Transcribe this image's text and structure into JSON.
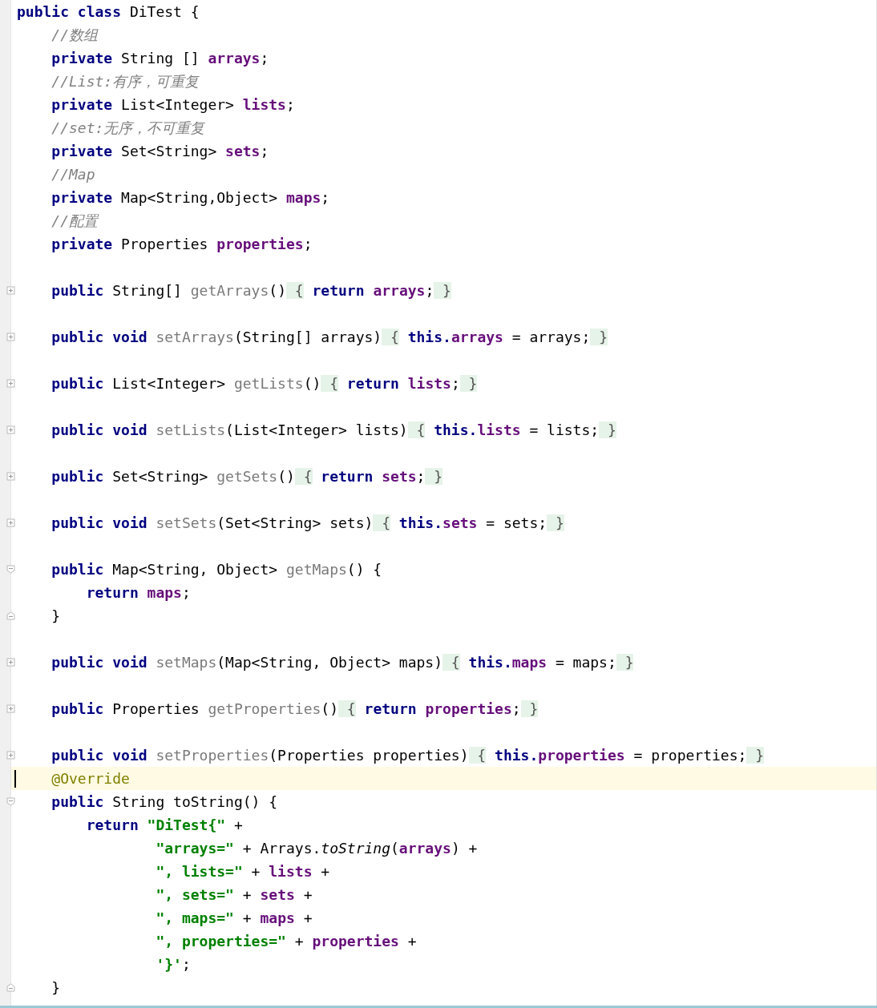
{
  "editor": {
    "lines": [
      {
        "kind": "code",
        "current": false,
        "tokens": [
          {
            "text": "public class ",
            "kind": "kw"
          },
          {
            "text": "DiTest {",
            "kind": "plain"
          }
        ]
      },
      {
        "kind": "code",
        "current": false,
        "tokens": [
          {
            "text": "    //数组",
            "kind": "comment"
          }
        ]
      },
      {
        "kind": "code",
        "current": false,
        "tokens": [
          {
            "text": "    private ",
            "kind": "kw"
          },
          {
            "text": "String [] ",
            "kind": "plain"
          },
          {
            "text": "arrays",
            "kind": "field"
          },
          {
            "text": ";",
            "kind": "plain"
          }
        ]
      },
      {
        "kind": "code",
        "current": false,
        "tokens": [
          {
            "text": "    //List:有序，可重复",
            "kind": "comment"
          }
        ]
      },
      {
        "kind": "code",
        "current": false,
        "tokens": [
          {
            "text": "    private ",
            "kind": "kw"
          },
          {
            "text": "List<Integer> ",
            "kind": "plain"
          },
          {
            "text": "lists",
            "kind": "field"
          },
          {
            "text": ";",
            "kind": "plain"
          }
        ]
      },
      {
        "kind": "code",
        "current": false,
        "tokens": [
          {
            "text": "    //set:无序，不可重复",
            "kind": "comment"
          }
        ]
      },
      {
        "kind": "code",
        "current": false,
        "tokens": [
          {
            "text": "    private ",
            "kind": "kw"
          },
          {
            "text": "Set<String> ",
            "kind": "plain"
          },
          {
            "text": "sets",
            "kind": "field"
          },
          {
            "text": ";",
            "kind": "plain"
          }
        ]
      },
      {
        "kind": "code",
        "current": false,
        "tokens": [
          {
            "text": "    //Map",
            "kind": "comment"
          }
        ]
      },
      {
        "kind": "code",
        "current": false,
        "tokens": [
          {
            "text": "    private ",
            "kind": "kw"
          },
          {
            "text": "Map<String,Object> ",
            "kind": "plain"
          },
          {
            "text": "maps",
            "kind": "field"
          },
          {
            "text": ";",
            "kind": "plain"
          }
        ]
      },
      {
        "kind": "code",
        "current": false,
        "tokens": [
          {
            "text": "    //配置",
            "kind": "comment"
          }
        ]
      },
      {
        "kind": "code",
        "current": false,
        "tokens": [
          {
            "text": "    private ",
            "kind": "kw"
          },
          {
            "text": "Properties ",
            "kind": "plain"
          },
          {
            "text": "properties",
            "kind": "field"
          },
          {
            "text": ";",
            "kind": "plain"
          }
        ]
      },
      {
        "kind": "blank",
        "current": false
      },
      {
        "kind": "code",
        "current": false,
        "fold": {
          "kind": "collapsed"
        },
        "tokens": [
          {
            "text": "    public ",
            "kind": "kw"
          },
          {
            "text": "String[] ",
            "kind": "plain"
          },
          {
            "text": "getArrays",
            "kind": "decl"
          },
          {
            "text": "()",
            "kind": "plain"
          },
          {
            "text": " {",
            "kind": "folded"
          },
          {
            "text": " return ",
            "kind": "kw"
          },
          {
            "text": "arrays",
            "kind": "field"
          },
          {
            "text": ";",
            "kind": "plain"
          },
          {
            "text": " }",
            "kind": "folded"
          }
        ]
      },
      {
        "kind": "blank",
        "current": false
      },
      {
        "kind": "code",
        "current": false,
        "fold": {
          "kind": "collapsed"
        },
        "tokens": [
          {
            "text": "    public void ",
            "kind": "kw"
          },
          {
            "text": "setArrays",
            "kind": "decl"
          },
          {
            "text": "(String[] arrays)",
            "kind": "plain"
          },
          {
            "text": " {",
            "kind": "folded"
          },
          {
            "text": " this.",
            "kind": "kw"
          },
          {
            "text": "arrays",
            "kind": "field"
          },
          {
            "text": " = arrays;",
            "kind": "plain"
          },
          {
            "text": " }",
            "kind": "folded"
          }
        ]
      },
      {
        "kind": "blank",
        "current": false
      },
      {
        "kind": "code",
        "current": false,
        "fold": {
          "kind": "collapsed"
        },
        "tokens": [
          {
            "text": "    public ",
            "kind": "kw"
          },
          {
            "text": "List<Integer> ",
            "kind": "plain"
          },
          {
            "text": "getLists",
            "kind": "decl"
          },
          {
            "text": "()",
            "kind": "plain"
          },
          {
            "text": " {",
            "kind": "folded"
          },
          {
            "text": " return ",
            "kind": "kw"
          },
          {
            "text": "lists",
            "kind": "field"
          },
          {
            "text": ";",
            "kind": "plain"
          },
          {
            "text": " }",
            "kind": "folded"
          }
        ]
      },
      {
        "kind": "blank",
        "current": false
      },
      {
        "kind": "code",
        "current": false,
        "fold": {
          "kind": "collapsed"
        },
        "tokens": [
          {
            "text": "    public void ",
            "kind": "kw"
          },
          {
            "text": "setLists",
            "kind": "decl"
          },
          {
            "text": "(List<Integer> lists)",
            "kind": "plain"
          },
          {
            "text": " {",
            "kind": "folded"
          },
          {
            "text": " this.",
            "kind": "kw"
          },
          {
            "text": "lists",
            "kind": "field"
          },
          {
            "text": " = lists;",
            "kind": "plain"
          },
          {
            "text": " }",
            "kind": "folded"
          }
        ]
      },
      {
        "kind": "blank",
        "current": false
      },
      {
        "kind": "code",
        "current": false,
        "fold": {
          "kind": "collapsed"
        },
        "tokens": [
          {
            "text": "    public ",
            "kind": "kw"
          },
          {
            "text": "Set<String> ",
            "kind": "plain"
          },
          {
            "text": "getSets",
            "kind": "decl"
          },
          {
            "text": "()",
            "kind": "plain"
          },
          {
            "text": " {",
            "kind": "folded"
          },
          {
            "text": " return ",
            "kind": "kw"
          },
          {
            "text": "sets",
            "kind": "field"
          },
          {
            "text": ";",
            "kind": "plain"
          },
          {
            "text": " }",
            "kind": "folded"
          }
        ]
      },
      {
        "kind": "blank",
        "current": false
      },
      {
        "kind": "code",
        "current": false,
        "fold": {
          "kind": "collapsed"
        },
        "tokens": [
          {
            "text": "    public void ",
            "kind": "kw"
          },
          {
            "text": "setSets",
            "kind": "decl"
          },
          {
            "text": "(Set<String> sets)",
            "kind": "plain"
          },
          {
            "text": " {",
            "kind": "folded"
          },
          {
            "text": " this.",
            "kind": "kw"
          },
          {
            "text": "sets",
            "kind": "field"
          },
          {
            "text": " = sets;",
            "kind": "plain"
          },
          {
            "text": " }",
            "kind": "folded"
          }
        ]
      },
      {
        "kind": "blank",
        "current": false
      },
      {
        "kind": "code",
        "current": false,
        "fold": {
          "kind": "open"
        },
        "tokens": [
          {
            "text": "    public ",
            "kind": "kw"
          },
          {
            "text": "Map<String, Object> ",
            "kind": "plain"
          },
          {
            "text": "getMaps",
            "kind": "decl"
          },
          {
            "text": "() {",
            "kind": "plain"
          }
        ]
      },
      {
        "kind": "code",
        "current": false,
        "tokens": [
          {
            "text": "        return ",
            "kind": "kw"
          },
          {
            "text": "maps",
            "kind": "field"
          },
          {
            "text": ";",
            "kind": "plain"
          }
        ]
      },
      {
        "kind": "code",
        "current": false,
        "fold": {
          "kind": "close"
        },
        "tokens": [
          {
            "text": "    }",
            "kind": "plain"
          }
        ]
      },
      {
        "kind": "blank",
        "current": false
      },
      {
        "kind": "code",
        "current": false,
        "fold": {
          "kind": "collapsed"
        },
        "tokens": [
          {
            "text": "    public void ",
            "kind": "kw"
          },
          {
            "text": "setMaps",
            "kind": "decl"
          },
          {
            "text": "(Map<String, Object> maps)",
            "kind": "plain"
          },
          {
            "text": " {",
            "kind": "folded"
          },
          {
            "text": " this.",
            "kind": "kw"
          },
          {
            "text": "maps",
            "kind": "field"
          },
          {
            "text": " = maps;",
            "kind": "plain"
          },
          {
            "text": " }",
            "kind": "folded"
          }
        ]
      },
      {
        "kind": "blank",
        "current": false
      },
      {
        "kind": "code",
        "current": false,
        "fold": {
          "kind": "collapsed"
        },
        "tokens": [
          {
            "text": "    public ",
            "kind": "kw"
          },
          {
            "text": "Properties ",
            "kind": "plain"
          },
          {
            "text": "getProperties",
            "kind": "decl"
          },
          {
            "text": "()",
            "kind": "plain"
          },
          {
            "text": " {",
            "kind": "folded"
          },
          {
            "text": " return ",
            "kind": "kw"
          },
          {
            "text": "properties",
            "kind": "field"
          },
          {
            "text": ";",
            "kind": "plain"
          },
          {
            "text": " }",
            "kind": "folded"
          }
        ]
      },
      {
        "kind": "blank",
        "current": false
      },
      {
        "kind": "code",
        "current": false,
        "fold": {
          "kind": "collapsed"
        },
        "tokens": [
          {
            "text": "    public void ",
            "kind": "kw"
          },
          {
            "text": "setProperties",
            "kind": "decl"
          },
          {
            "text": "(Properties properties)",
            "kind": "plain"
          },
          {
            "text": " {",
            "kind": "folded"
          },
          {
            "text": " this.",
            "kind": "kw"
          },
          {
            "text": "properties",
            "kind": "field"
          },
          {
            "text": " = properties;",
            "kind": "plain"
          },
          {
            "text": " }",
            "kind": "folded"
          }
        ]
      },
      {
        "kind": "code",
        "current": true,
        "tokens": [
          {
            "text": "    @Override",
            "kind": "annot"
          }
        ]
      },
      {
        "kind": "code",
        "current": false,
        "fold": {
          "kind": "open"
        },
        "tokens": [
          {
            "text": "    public ",
            "kind": "kw"
          },
          {
            "text": "String toString() {",
            "kind": "plain"
          }
        ]
      },
      {
        "kind": "code",
        "current": false,
        "tokens": [
          {
            "text": "        return ",
            "kind": "kw"
          },
          {
            "text": "\"DiTest{\"",
            "kind": "str"
          },
          {
            "text": " +",
            "kind": "plain"
          }
        ]
      },
      {
        "kind": "code",
        "current": false,
        "tokens": [
          {
            "text": "                \"arrays=\"",
            "kind": "str"
          },
          {
            "text": " + Arrays.",
            "kind": "plain"
          },
          {
            "text": "toString",
            "kind": "static"
          },
          {
            "text": "(",
            "kind": "plain"
          },
          {
            "text": "arrays",
            "kind": "field"
          },
          {
            "text": ") +",
            "kind": "plain"
          }
        ]
      },
      {
        "kind": "code",
        "current": false,
        "tokens": [
          {
            "text": "                \", lists=\"",
            "kind": "str"
          },
          {
            "text": " + ",
            "kind": "plain"
          },
          {
            "text": "lists",
            "kind": "field"
          },
          {
            "text": " +",
            "kind": "plain"
          }
        ]
      },
      {
        "kind": "code",
        "current": false,
        "tokens": [
          {
            "text": "                \", sets=\"",
            "kind": "str"
          },
          {
            "text": " + ",
            "kind": "plain"
          },
          {
            "text": "sets",
            "kind": "field"
          },
          {
            "text": " +",
            "kind": "plain"
          }
        ]
      },
      {
        "kind": "code",
        "current": false,
        "tokens": [
          {
            "text": "                \", maps=\"",
            "kind": "str"
          },
          {
            "text": " + ",
            "kind": "plain"
          },
          {
            "text": "maps",
            "kind": "field"
          },
          {
            "text": " +",
            "kind": "plain"
          }
        ]
      },
      {
        "kind": "code",
        "current": false,
        "tokens": [
          {
            "text": "                \", properties=\"",
            "kind": "str"
          },
          {
            "text": " + ",
            "kind": "plain"
          },
          {
            "text": "properties",
            "kind": "field"
          },
          {
            "text": " +",
            "kind": "plain"
          }
        ]
      },
      {
        "kind": "code",
        "current": false,
        "tokens": [
          {
            "text": "                '}'",
            "kind": "str"
          },
          {
            "text": ";",
            "kind": "plain"
          }
        ]
      },
      {
        "kind": "code",
        "current": false,
        "fold": {
          "kind": "close"
        },
        "tokens": [
          {
            "text": "    }",
            "kind": "plain"
          }
        ]
      }
    ]
  }
}
